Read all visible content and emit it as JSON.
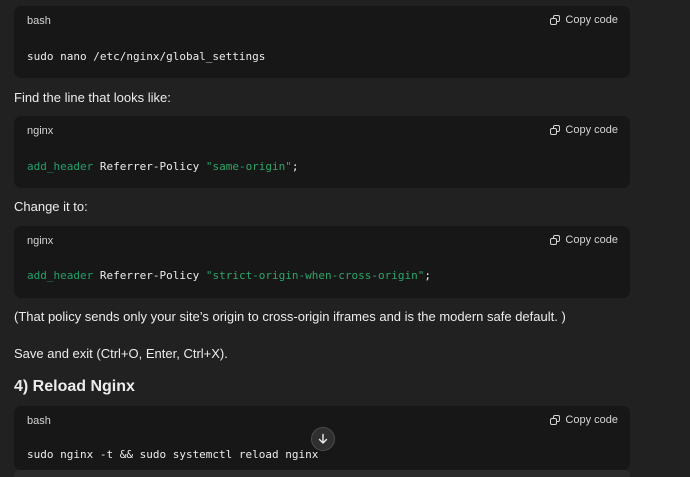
{
  "blocks": [
    {
      "lang": "bash",
      "copy_label": "Copy code",
      "code": "sudo nano /etc/nginx/global_settings"
    },
    {
      "lang": "nginx",
      "copy_label": "Copy code",
      "directive": "add_header",
      "name": "Referrer-Policy",
      "value": "\"same-origin\"",
      "end": ";"
    },
    {
      "lang": "nginx",
      "copy_label": "Copy code",
      "directive": "add_header",
      "name": "Referrer-Policy",
      "value": "\"strict-origin-when-cross-origin\"",
      "end": ";"
    },
    {
      "lang": "bash",
      "copy_label": "Copy code",
      "code": "sudo nginx -t && sudo systemctl reload nginx"
    }
  ],
  "text": {
    "find_line": "Find the line that looks like:",
    "change_it": "Change it to:",
    "policy_note": "(That policy sends only your site’s origin to cross-origin iframes and is the modern safe default. )",
    "save_exit": "Save and exit (Ctrl+O, Enter, Ctrl+X).",
    "reload_heading": "4) Reload Nginx"
  },
  "icons": {
    "copy": "copy-icon",
    "scroll_down": "arrow-down-icon"
  },
  "colors": {
    "background": "#212121",
    "code_background": "#171717",
    "keyword": "#22a06b",
    "string": "#2fa56a"
  }
}
